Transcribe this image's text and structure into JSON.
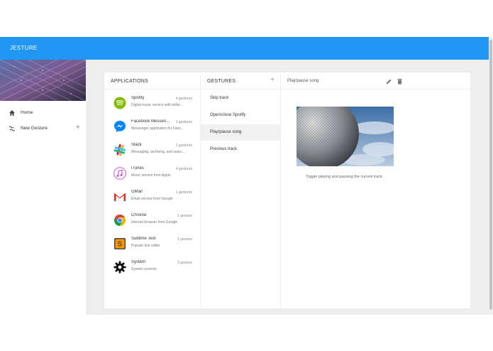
{
  "app": {
    "title": "JESTURE"
  },
  "sidebar": {
    "items": [
      {
        "label": "Home",
        "icon": "home-icon"
      },
      {
        "label": "New Gesture",
        "icon": "gesture-icon",
        "action": "+"
      }
    ]
  },
  "applications": {
    "header": "APPLICATIONS",
    "items": [
      {
        "name": "Spotify",
        "count": "4 gestures",
        "desc": "Digital music service with millio...",
        "icon": "spotify-icon"
      },
      {
        "name": "Facebook Messen...",
        "count": "1 gestures",
        "desc": "Messenger application for Face...",
        "icon": "messenger-icon"
      },
      {
        "name": "Slack",
        "count": "1 gestures",
        "desc": "Messaging, archiving, and searc...",
        "icon": "slack-icon"
      },
      {
        "name": "iTunes",
        "count": "4 gestures",
        "desc": "Music service from Apple",
        "icon": "itunes-icon"
      },
      {
        "name": "GMail",
        "count": "1 gestures",
        "desc": "Email service from Google",
        "icon": "gmail-icon"
      },
      {
        "name": "Chrome",
        "count": "1 gesture",
        "desc": "Internet browser from Google",
        "icon": "chrome-icon"
      },
      {
        "name": "Sublime Text",
        "count": "1 gesture",
        "desc": "Popular text editor",
        "icon": "sublime-icon"
      },
      {
        "name": "System",
        "count": "3 gesture",
        "desc": "System controls",
        "icon": "gear-icon"
      }
    ]
  },
  "gestures": {
    "header": "GESTURES",
    "add": "+",
    "selected_index": 2,
    "items": [
      {
        "label": "Skip track"
      },
      {
        "label": "Open/close Spotify"
      },
      {
        "label": "Play/pause song"
      },
      {
        "label": "Previous track"
      }
    ]
  },
  "detail": {
    "title": "Play/pause song",
    "description": "Toggle playing and pausing the current track."
  },
  "colors": {
    "accent": "#2196f3",
    "background": "#eeeeee"
  }
}
